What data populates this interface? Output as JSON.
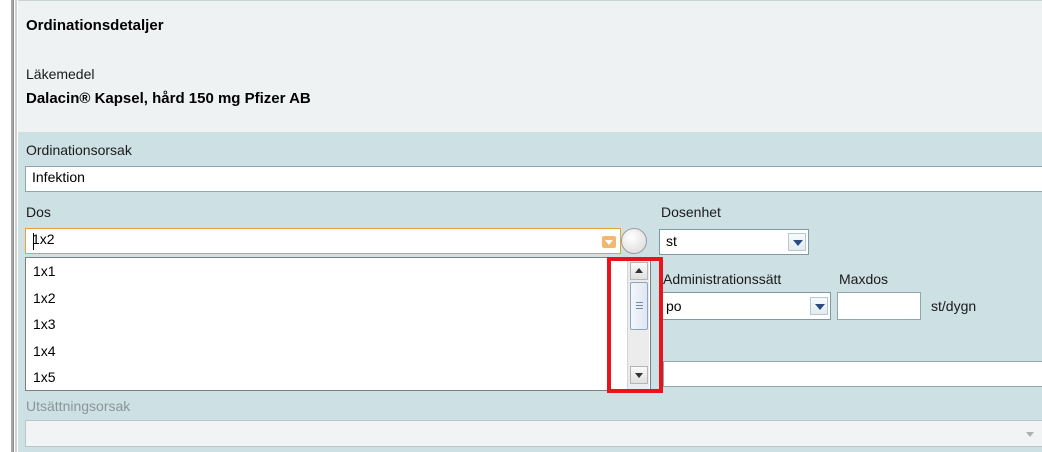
{
  "section_title": "Ordinationsdetaljer",
  "drug": {
    "label": "Läkemedel",
    "name": "Dalacin® Kapsel, hård 150 mg Pfizer AB"
  },
  "ordination_reason": {
    "label": "Ordinationsorsak",
    "value": "Infektion"
  },
  "dose": {
    "label": "Dos",
    "value": "1x2",
    "options": [
      "1x1",
      "1x2",
      "1x3",
      "1x4",
      "1x5"
    ]
  },
  "dose_unit": {
    "label": "Dosenhet",
    "value": "st"
  },
  "administration": {
    "label": "Administrationssätt",
    "value": "po"
  },
  "max_dose": {
    "label": "Maxdos",
    "value": "",
    "unit": "st/dygn"
  },
  "discontinuation_reason": {
    "label": "Utsättningsorsak",
    "value": ""
  },
  "colors": {
    "highlight": "#e8141c",
    "panel": "#cde0e4",
    "focus_border": "#e2a23a"
  },
  "icons": [
    "dropdown-arrow-icon",
    "radio-icon",
    "scroll-up-icon",
    "scroll-down-icon",
    "scroll-thumb-grip-icon"
  ]
}
